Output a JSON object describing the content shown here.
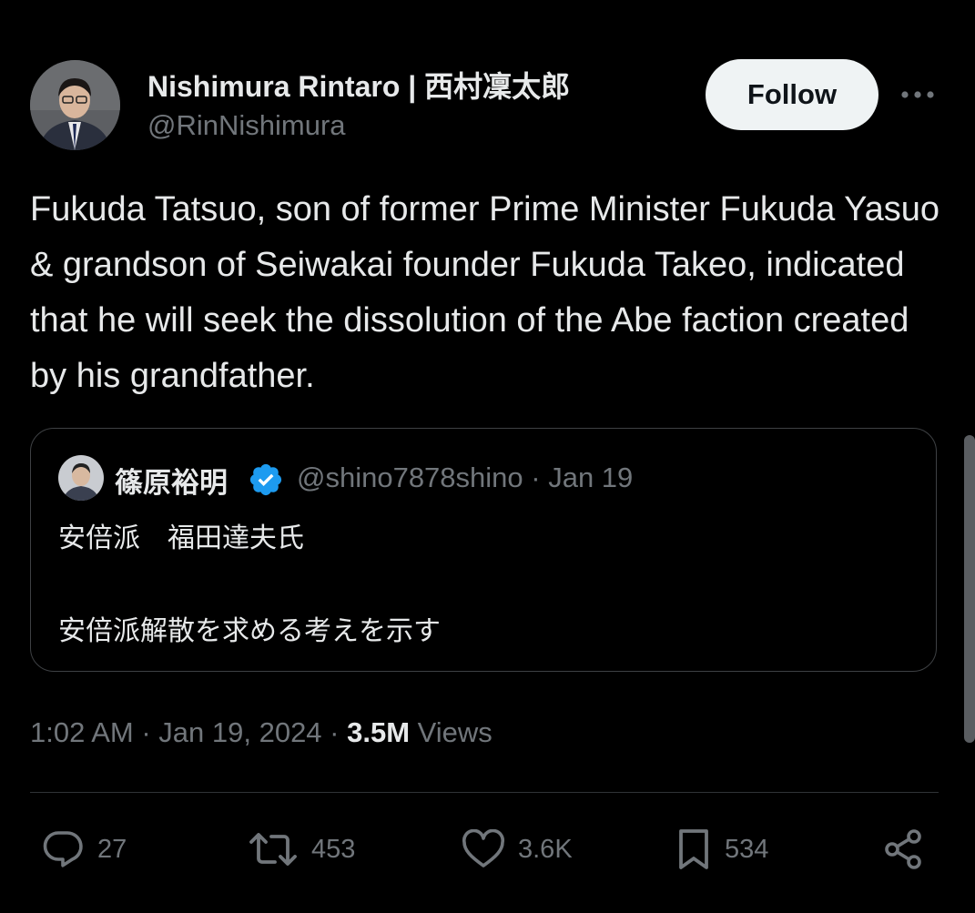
{
  "author": {
    "name": "Nishimura Rintaro | 西村凜太郎",
    "handle": "@RinNishimura"
  },
  "follow_label": "Follow",
  "tweet_text": "Fukuda Tatsuo, son of former Prime Minister Fukuda Yasuo & grandson of Seiwakai founder Fukuda Takeo, indicated that he will seek the dissolution of the Abe faction created by his grandfather.",
  "quote": {
    "name": "篠原裕明",
    "handle_and_date": "@shino7878shino · Jan 19",
    "line1": "安倍派　福田達夫氏",
    "line2": "安倍派解散を求める考えを示す"
  },
  "timestamp": "1:02 AM · Jan 19, 2024 · ",
  "views_count": "3.5M",
  "views_label": " Views",
  "actions": {
    "replies": "27",
    "retweets": "453",
    "likes": "3.6K",
    "bookmarks": "534"
  },
  "colors": {
    "background": "#000000",
    "text": "#e7e9ea",
    "secondary_text": "#71767b",
    "verified_blue": "#1d9bf0",
    "follow_bg": "#eff3f4"
  },
  "icons": [
    "avatar",
    "verified-badge-icon",
    "more-icon",
    "reply-icon",
    "retweet-icon",
    "like-icon",
    "bookmark-icon",
    "share-icon"
  ]
}
